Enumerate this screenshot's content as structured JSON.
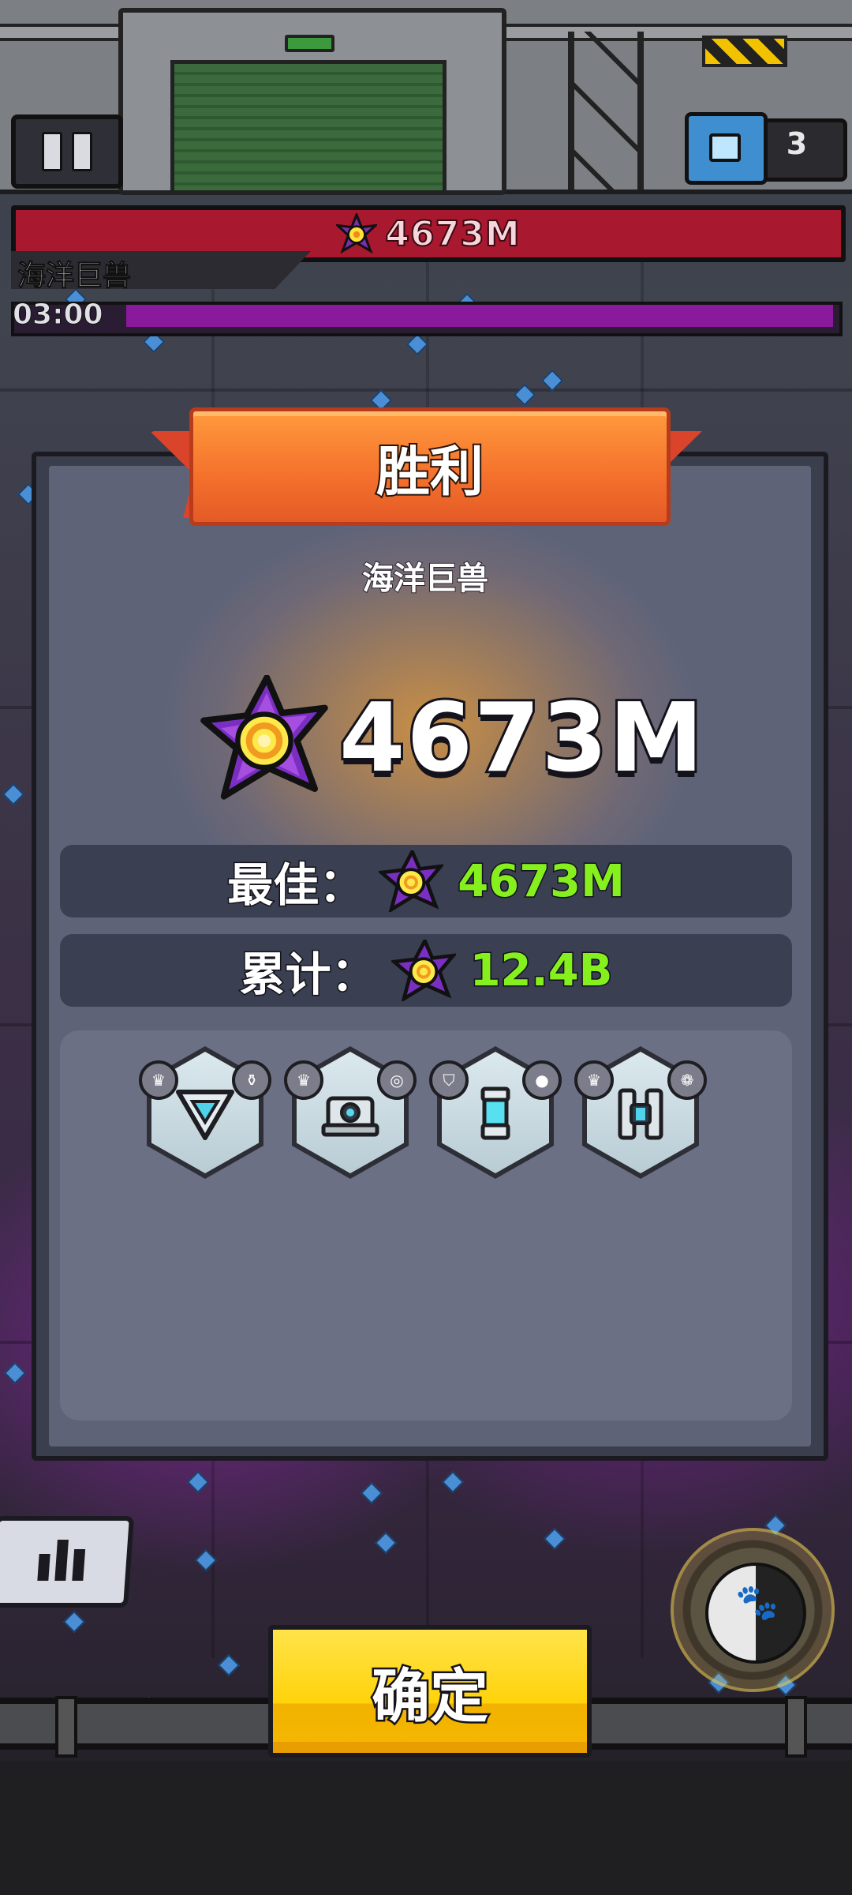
{
  "hud": {
    "boss_hp": "4673M",
    "boss_name": "海洋巨兽",
    "timer": "03:00",
    "chest_count": "3"
  },
  "result": {
    "title": "胜利",
    "boss_name": "海洋巨兽",
    "damage": "4673M",
    "best_label": "最佳：",
    "best_value": "4673M",
    "total_label": "累计：",
    "total_value": "12.4B"
  },
  "rewards": [
    {
      "icon": "triangle-gem-icon",
      "badge_left": "crown-icon",
      "badge_right": "bottle-icon"
    },
    {
      "icon": "turret-icon",
      "badge_left": "crown-icon",
      "badge_right": "shell-icon"
    },
    {
      "icon": "capsule-icon",
      "badge_left": "shield-icon",
      "badge_right": "ball-icon"
    },
    {
      "icon": "battery-icon",
      "badge_left": "crown-icon",
      "badge_right": "creature-icon"
    }
  ],
  "buttons": {
    "confirm": "确定"
  },
  "colors": {
    "accent_green": "#86f01e",
    "banner_orange": "#f4702c",
    "confirm_yellow": "#ffd30a",
    "boss_bar_red": "#a8182e"
  }
}
